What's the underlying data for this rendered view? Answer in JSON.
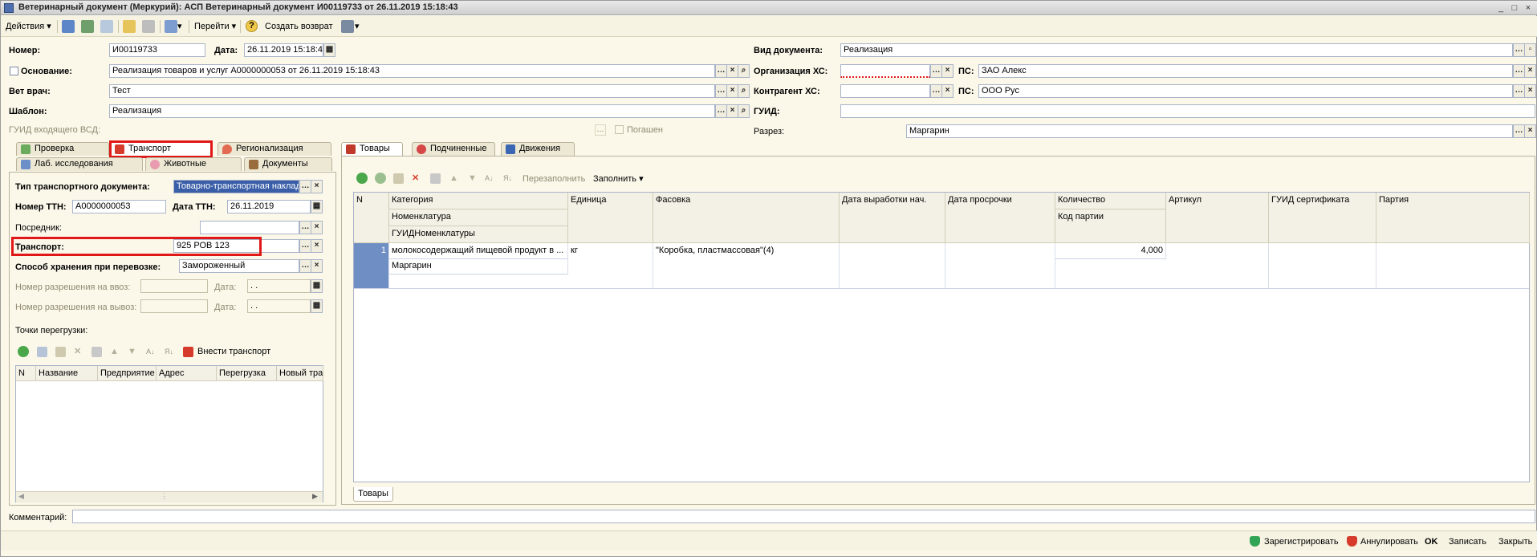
{
  "window": {
    "title": "Ветеринарный документ (Меркурий): АСП Ветеринарный документ И00119733 от 26.11.2019 15:18:43",
    "min": "_",
    "max": "□",
    "close": "×"
  },
  "toolbar": {
    "actions": "Действия",
    "goto": "Перейти",
    "help": "?",
    "create_return": "Создать возврат"
  },
  "header": {
    "number_label": "Номер:",
    "number_value": "И00119733",
    "date_label": "Дата:",
    "date_value": "26.11.2019 15:18:4",
    "basis_label": "Основание:",
    "basis_value": "Реализация товаров и услуг А0000000053 от 26.11.2019 15:18:43",
    "vet_label": "Вет врач:",
    "vet_value": "Тест",
    "template_label": "Шаблон:",
    "template_value": "Реализация",
    "guid_incoming_label": "ГУИД входящего ВСД:",
    "guid_incoming_btn": "...",
    "paid_label": "Погашен",
    "doc_type_label": "Вид документа:",
    "doc_type_value": "Реализация",
    "org_label": "Организация ХС:",
    "org_value": "",
    "ps1_label": "ПС:",
    "ps1_value": "ЗАО Алекс",
    "counterparty_label": "Контрагент ХС:",
    "counterparty_value": "",
    "ps2_label": "ПС:",
    "ps2_value": "ООО Рус",
    "guid_label": "ГУИД:",
    "guid_value": "",
    "section_label": "Разрез:",
    "section_value": "Маргарин"
  },
  "left_tabs": {
    "row1": [
      "Проверка",
      "Транспорт",
      "Регионализация"
    ],
    "row2": [
      "Лаб. исследования",
      "Животные",
      "Документы"
    ]
  },
  "transport": {
    "doc_type_label": "Тип транспортного документа:",
    "doc_type_value": "Товарно-транспортная наклад",
    "ttn_label": "Номер ТТН:",
    "ttn_value": "А0000000053",
    "ttn_date_label": "Дата ТТН:",
    "ttn_date_value": "26.11.2019",
    "intermediary_label": "Посредник:",
    "intermediary_value": "",
    "transport_label": "Транспорт:",
    "transport_value": "925 РОВ 123",
    "storage_label": "Способ хранения при перевозке:",
    "storage_value": "Замороженный",
    "import_label": "Номер разрешения на ввоз:",
    "import_date_label": "Дата:",
    "import_date_value": " .  .",
    "export_label": "Номер разрешения на вывоз:",
    "export_date_label": "Дата:",
    "export_date_value": " .  .",
    "transfer_points_label": "Точки перегрузки:",
    "add_transport": "Внести транспорт",
    "grid_headers": [
      "N",
      "Название",
      "Предприятие",
      "Адрес",
      "Перегрузка",
      "Новый тра"
    ]
  },
  "right_tabs": [
    "Товары",
    "Подчиненные",
    "Движения"
  ],
  "goods": {
    "refill": "Перезаполнить",
    "fill": "Заполнить",
    "headers": {
      "n": "N",
      "category": "Категория",
      "nomenclature": "Номенклатура",
      "guid_nomenclature": "ГУИДНоменклатуры",
      "unit": "Единица",
      "packing": "Фасовка",
      "prod_date": "Дата выработки нач.",
      "expiry": "Дата просрочки",
      "quantity": "Количество",
      "batch_code": "Код партии",
      "article": "Артикул",
      "cert_guid": "ГУИД сертификата",
      "batch": "Партия"
    },
    "rows": [
      {
        "n": "1",
        "category": "молокосодержащий пищевой продукт в ...",
        "nomenclature": "Маргарин",
        "unit": "кг",
        "packing": "\"Коробка, пластмассовая\"(4)",
        "quantity": "4,000"
      }
    ],
    "bottom_tab": "Товары"
  },
  "comment_label": "Комментарий:",
  "comment_value": "",
  "status": {
    "register": "Зарегистрировать",
    "cancel": "Аннулировать",
    "ok": "OK",
    "save": "Записать",
    "close": "Закрыть"
  },
  "colors": {
    "highlight": "#e01818",
    "background": "#fbf8ea",
    "selection": "#3a5fa8"
  }
}
